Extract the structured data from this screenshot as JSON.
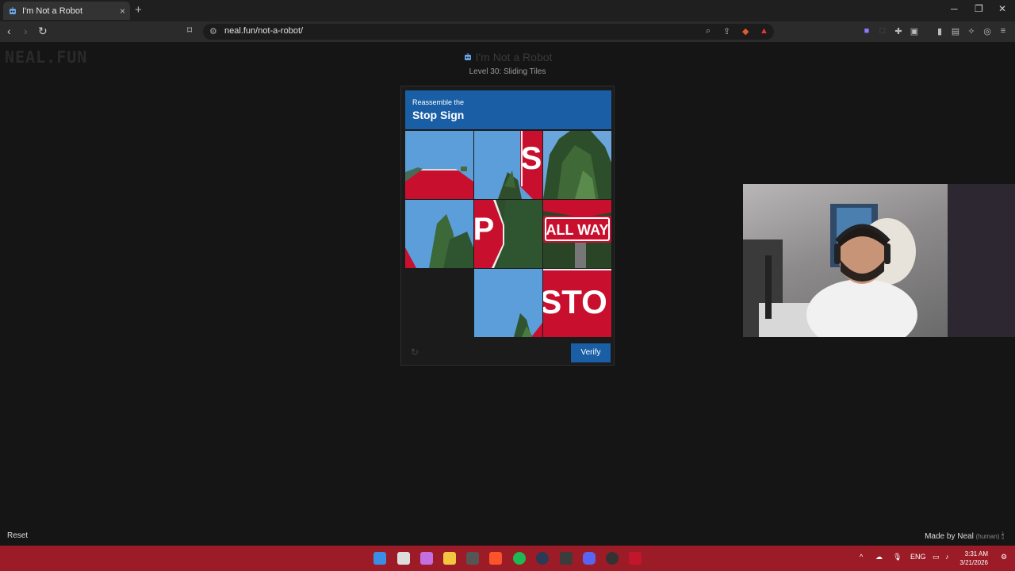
{
  "browser": {
    "tab_title": "I'm Not a Robot",
    "new_tab": "+",
    "close_tab": "×",
    "url": "neal.fun/not-a-robot/"
  },
  "page": {
    "logo": "NEAL.FUN",
    "title": "I'm Not a Robot",
    "level": "Level 30: Sliding Tiles"
  },
  "captcha": {
    "prompt": "Reassemble the",
    "target": "Stop Sign",
    "verify_label": "Verify",
    "tiles_text": [
      "S",
      "P",
      "ALL WAY",
      "STO"
    ]
  },
  "footer": {
    "reset": "Reset",
    "made_by": "Made by Neal",
    "made_by_note": "(human)"
  },
  "taskbar": {
    "lang": "ENG",
    "time": "3:31 AM",
    "date": "3/21/2026"
  },
  "colors": {
    "accent": "#1a5fa6",
    "sign_red": "#c8102e",
    "taskbar": "#9b1c27",
    "sky": "#5b9ed9"
  }
}
